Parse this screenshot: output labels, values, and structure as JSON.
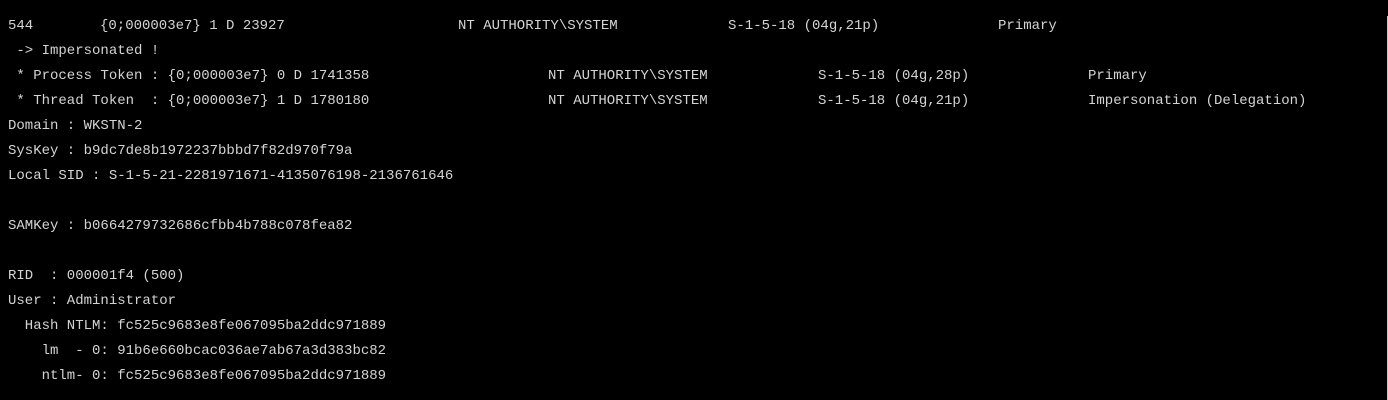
{
  "terminal": {
    "lines": [
      [
        "544",
        "{0;000003e7} 1 D 23927",
        "NT AUTHORITY\\SYSTEM",
        "S-1-5-18 (04g,21p)",
        "Primary"
      ],
      [
        " -> Impersonated !"
      ],
      [
        " * Process Token : {0;000003e7} 0 D 1741358",
        "NT AUTHORITY\\SYSTEM",
        "S-1-5-18 (04g,28p)",
        "Primary"
      ],
      [
        " * Thread Token  : {0;000003e7} 1 D 1780180",
        "NT AUTHORITY\\SYSTEM",
        "S-1-5-18 (04g,21p)",
        "Impersonation (Delegation)"
      ],
      [
        "Domain : WKSTN-2"
      ],
      [
        "SysKey : b9dc7de8b1972237bbbd7f82d970f79a"
      ],
      [
        "Local SID : S-1-5-21-2281971671-4135076198-2136761646"
      ],
      [
        ""
      ],
      [
        "SAMKey : b0664279732686cfbb4b788c078fea82"
      ],
      [
        ""
      ],
      [
        "RID  : 000001f4 (500)"
      ],
      [
        "User : Administrator"
      ],
      [
        "  Hash NTLM: fc525c9683e8fe067095ba2ddc971889"
      ],
      [
        "    lm  - 0: 91b6e660bcac036ae7ab67a3d383bc82"
      ],
      [
        "    ntlm- 0: fc525c9683e8fe067095ba2ddc971889"
      ]
    ]
  }
}
